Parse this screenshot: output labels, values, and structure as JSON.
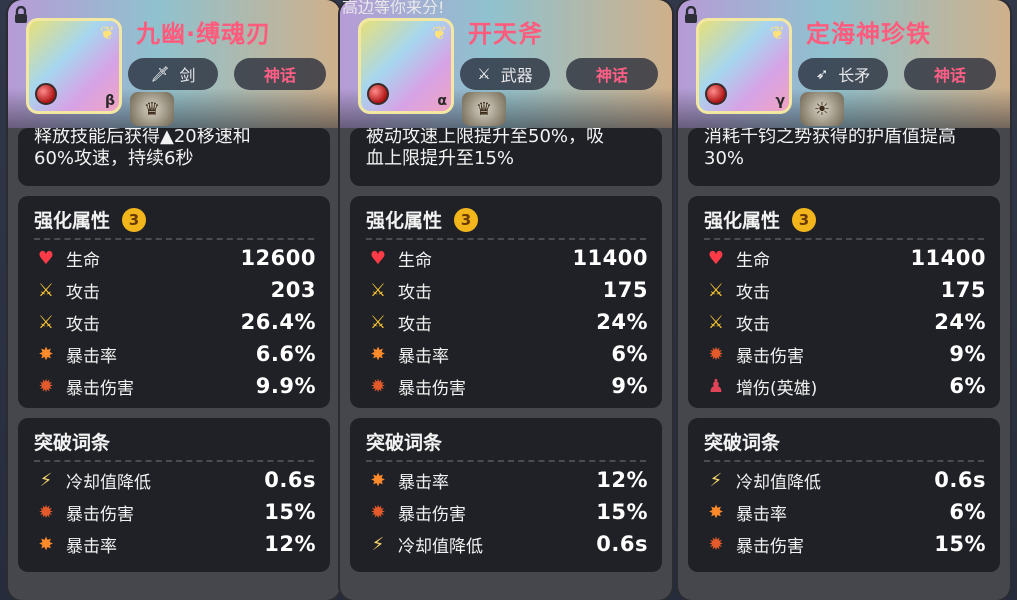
{
  "top_partial_text": "高边等你来分!",
  "cards": [
    {
      "title": "九幽·缚魂刃",
      "type_label": "剑",
      "type_icon": "sword-icon",
      "rarity_label": "神话",
      "greek": "β",
      "desc_line1": "释放技能后获得▲20移速和",
      "desc_line2": "60%攻速，持续6秒",
      "enhance_title": "强化属性",
      "enhance_level": "3",
      "enhance_rows": [
        {
          "icon": "heart-icon",
          "label": "生命",
          "value": "12600"
        },
        {
          "icon": "sword-icon",
          "label": "攻击",
          "value": "203"
        },
        {
          "icon": "sword-icon",
          "label": "攻击",
          "value": "26.4%"
        },
        {
          "icon": "crit-rate-icon",
          "label": "暴击率",
          "value": "6.6%"
        },
        {
          "icon": "crit-damage-icon",
          "label": "暴击伤害",
          "value": "9.9%"
        }
      ],
      "break_title": "突破词条",
      "break_rows": [
        {
          "icon": "cooldown-icon",
          "label": "冷却值降低",
          "value": "0.6s"
        },
        {
          "icon": "crit-damage-icon",
          "label": "暴击伤害",
          "value": "15%"
        },
        {
          "icon": "crit-rate-icon",
          "label": "暴击率",
          "value": "12%"
        }
      ]
    },
    {
      "title": "开天斧",
      "type_label": "武器",
      "type_icon": "crossed-swords-icon",
      "rarity_label": "神话",
      "greek": "α",
      "desc_line1": "被动攻速上限提升至50%，吸",
      "desc_line2": "血上限提升至15%",
      "enhance_title": "强化属性",
      "enhance_level": "3",
      "enhance_rows": [
        {
          "icon": "heart-icon",
          "label": "生命",
          "value": "11400"
        },
        {
          "icon": "sword-icon",
          "label": "攻击",
          "value": "175"
        },
        {
          "icon": "sword-icon",
          "label": "攻击",
          "value": "24%"
        },
        {
          "icon": "crit-rate-icon",
          "label": "暴击率",
          "value": "6%"
        },
        {
          "icon": "crit-damage-icon",
          "label": "暴击伤害",
          "value": "9%"
        }
      ],
      "break_title": "突破词条",
      "break_rows": [
        {
          "icon": "crit-rate-icon",
          "label": "暴击率",
          "value": "12%"
        },
        {
          "icon": "crit-damage-icon",
          "label": "暴击伤害",
          "value": "15%"
        },
        {
          "icon": "cooldown-icon",
          "label": "冷却值降低",
          "value": "0.6s"
        }
      ]
    },
    {
      "title": "定海神珍铁",
      "type_label": "长矛",
      "type_icon": "spear-icon",
      "rarity_label": "神话",
      "greek": "γ",
      "desc_line1": "消耗千钧之势获得的护盾值提高",
      "desc_line2": "30%",
      "enhance_title": "强化属性",
      "enhance_level": "3",
      "enhance_rows": [
        {
          "icon": "heart-icon",
          "label": "生命",
          "value": "11400"
        },
        {
          "icon": "sword-icon",
          "label": "攻击",
          "value": "175"
        },
        {
          "icon": "sword-icon",
          "label": "攻击",
          "value": "24%"
        },
        {
          "icon": "crit-damage-icon",
          "label": "暴击伤害",
          "value": "9%"
        },
        {
          "icon": "hero-damage-icon",
          "label": "增伤(英雄)",
          "value": "6%"
        }
      ],
      "break_title": "突破词条",
      "break_rows": [
        {
          "icon": "cooldown-icon",
          "label": "冷却值降低",
          "value": "0.6s"
        },
        {
          "icon": "crit-rate-icon",
          "label": "暴击率",
          "value": "6%"
        },
        {
          "icon": "crit-damage-icon",
          "label": "暴击伤害",
          "value": "15%"
        }
      ]
    }
  ]
}
